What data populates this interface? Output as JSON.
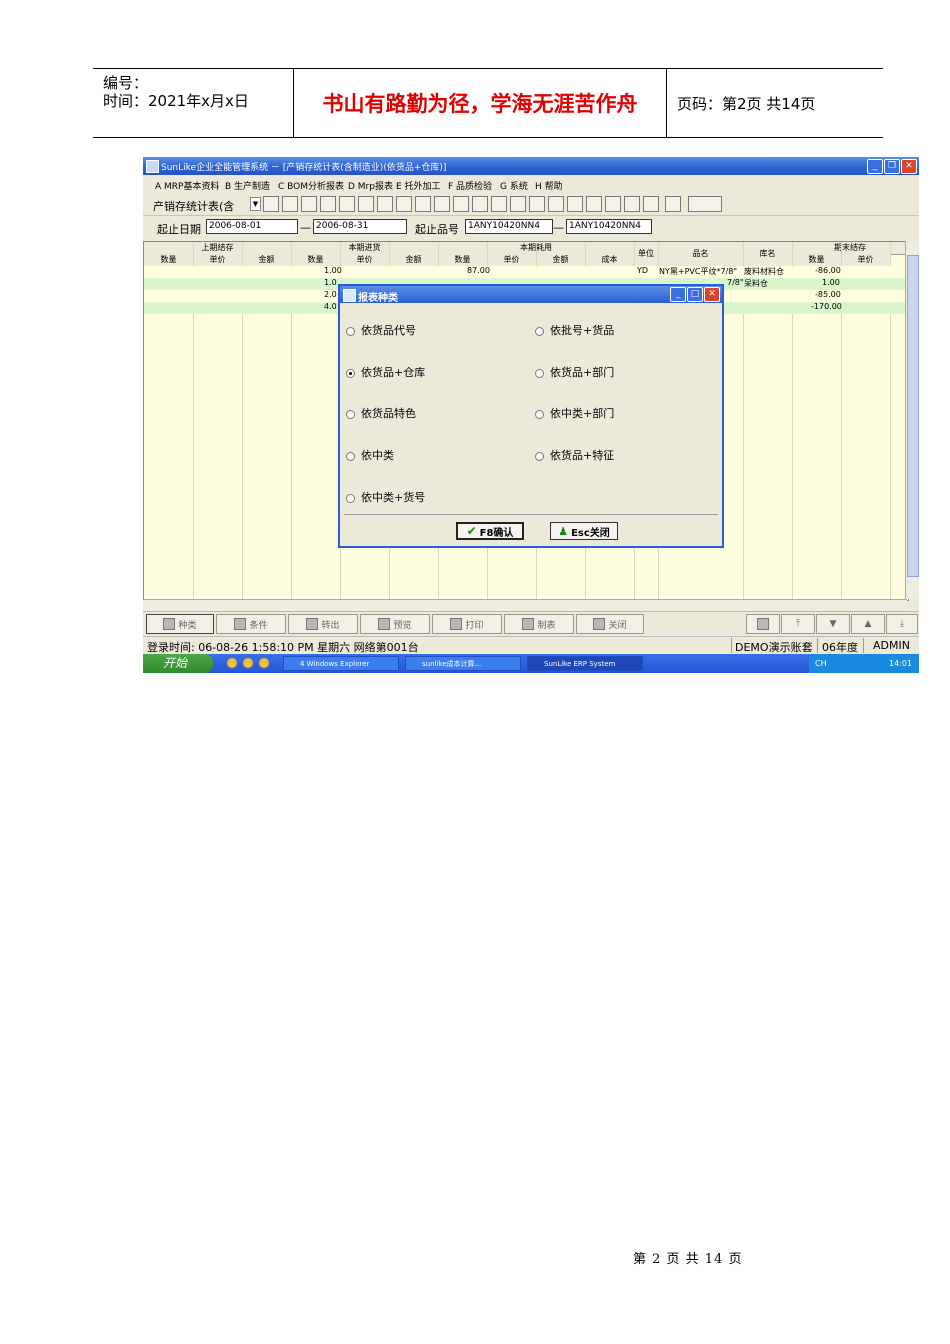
{
  "doc_header": {
    "number_label": "编号：",
    "time_label": "时间：2021年x月x日",
    "motto": "书山有路勤为径，学海无涯苦作舟",
    "page_label": "页码：第2页 共14页"
  },
  "doc_footer": {
    "page_text": "第 2 页 共 14 页"
  },
  "window": {
    "title": "SunLike企业全能管理系统 － [产销存统计表(含制造业)(依货品+仓库)]",
    "menu": [
      "A MRP基本资料",
      "B 生产制造",
      "C BOM分析报表",
      "D Mrp报表",
      "E 托外加工",
      "F 品质检验",
      "G 系统",
      "H 帮助"
    ],
    "toolbar_label": "产销存统计表(含",
    "filter": {
      "date_label": "起止日期",
      "date_from": "2006-08-01",
      "date_to": "2006-08-31",
      "dash": "—",
      "item_label": "起止品号",
      "item_from": "1ANY10420NN4",
      "item_to": "1ANY10420NN4"
    },
    "grid": {
      "group_headers": [
        "上期结存",
        "本期进货",
        "本期耗用",
        "单位",
        "品名",
        "库名",
        "期末结存"
      ],
      "sub_headers": [
        "数量",
        "单价",
        "金额",
        "数量",
        "单价",
        "金额",
        "数量",
        "单价",
        "金额",
        "成本",
        "数量",
        "单价"
      ],
      "rows": [
        {
          "in_qty": "1.00",
          "use_qty": "87.00",
          "unit": "YD",
          "name": "NY黑+PVC平纹*7/8\"",
          "store": "废料材料仓",
          "end_qty": "-86.00"
        },
        {
          "in_qty": "1.0",
          "use_qty": "",
          "unit": "",
          "name": "7/8\"",
          "store": "呆料仓",
          "end_qty": "1.00"
        },
        {
          "in_qty": "2.0",
          "use_qty": "",
          "unit": "",
          "name": "",
          "store": "",
          "end_qty": "-85.00"
        },
        {
          "in_qty": "4.0",
          "use_qty": "",
          "unit": "",
          "name": "",
          "store": "",
          "end_qty": "-170.00"
        }
      ]
    },
    "bottom_buttons": [
      "种类",
      "条件",
      "转出",
      "预览",
      "打印",
      "制表",
      "关闭"
    ],
    "status": {
      "login": "登录时间:  06-08-26 1:58:10 PM  星期六   网络第001台",
      "account": "DEMO演示账套",
      "year": "06年度",
      "user": "ADMIN"
    },
    "taskbar": {
      "start": "开始",
      "tasks": [
        "4 Windows Explorer",
        "sunlike成本计算...",
        "SunLike ERP System"
      ],
      "tray_lang": "CH",
      "clock": "14:01"
    }
  },
  "dialog": {
    "title": "报表种类",
    "options": [
      {
        "label": "依货品代号",
        "selected": false
      },
      {
        "label": "依批号+货品",
        "selected": false
      },
      {
        "label": "依货品+仓库",
        "selected": true
      },
      {
        "label": "依货品+部门",
        "selected": false
      },
      {
        "label": "依货品特色",
        "selected": false
      },
      {
        "label": "依中类+部门",
        "selected": false
      },
      {
        "label": "依中类",
        "selected": false
      },
      {
        "label": "依货品+特征",
        "selected": false
      },
      {
        "label": "依中类+货号",
        "selected": false
      }
    ],
    "ok_label": "F8确认",
    "cancel_label": "Esc关闭"
  }
}
